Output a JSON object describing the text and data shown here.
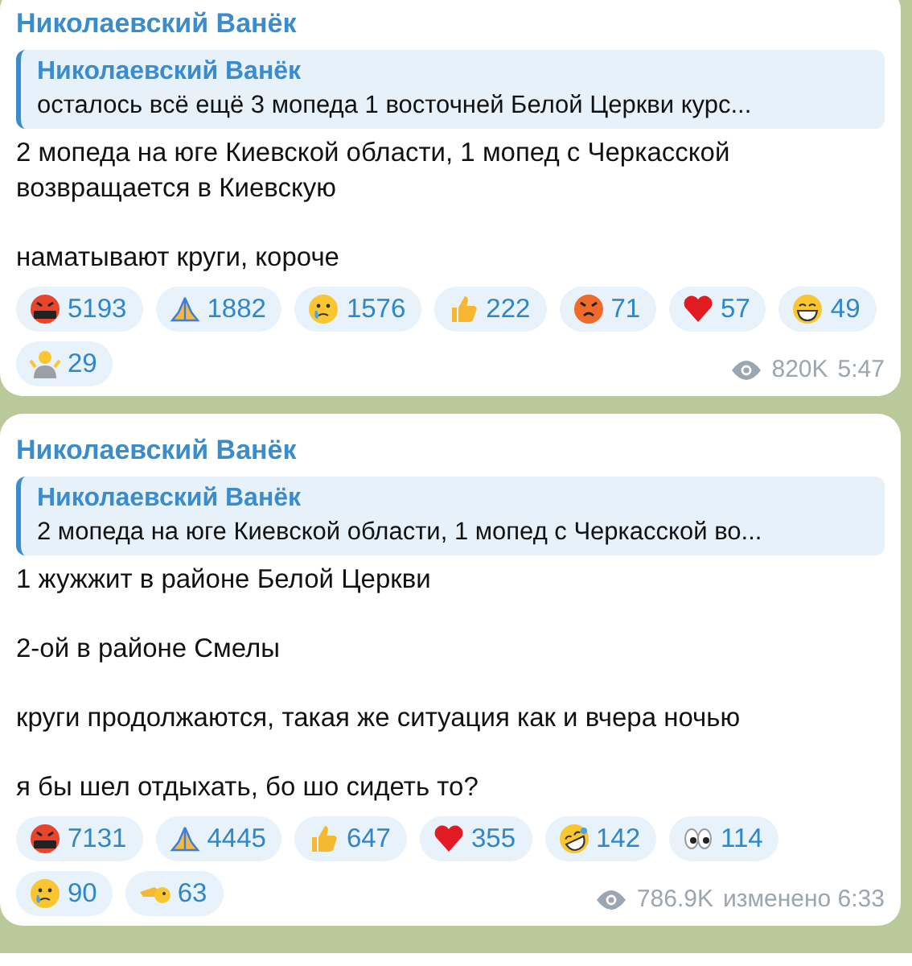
{
  "messages": [
    {
      "author": "Николаевский Ванёк",
      "reply": {
        "author": "Николаевский Ванёк",
        "text": "осталось всё ещё 3 мопеда  1 восточней Белой Церкви курс..."
      },
      "paragraphs": [
        "2 мопеда на юге Киевской области, 1 мопед с Черкасской возвращается в Киевскую",
        "наматывают круги, короче"
      ],
      "reactions": [
        {
          "kind": "cursing",
          "count": "5193"
        },
        {
          "kind": "pray",
          "count": "1882"
        },
        {
          "kind": "cry",
          "count": "1576"
        },
        {
          "kind": "thumbs",
          "count": "222"
        },
        {
          "kind": "angry",
          "count": "71"
        },
        {
          "kind": "heart",
          "count": "57"
        },
        {
          "kind": "grin",
          "count": "49"
        },
        {
          "kind": "shrug",
          "count": "29"
        }
      ],
      "views": "820K",
      "time": "5:47"
    },
    {
      "author": "Николаевский Ванёк",
      "reply": {
        "author": "Николаевский Ванёк",
        "text": "2 мопеда на юге Киевской области, 1 мопед с Черкасской во..."
      },
      "paragraphs": [
        "1 жужжит в районе Белой Церкви",
        "2-ой в районе Смелы",
        "круги продолжаются, такая же ситуация как и вчера ночью",
        "я бы шел отдыхать, бо шо сидеть то?"
      ],
      "reactions": [
        {
          "kind": "cursing",
          "count": "7131"
        },
        {
          "kind": "pray",
          "count": "4445"
        },
        {
          "kind": "thumbs",
          "count": "647"
        },
        {
          "kind": "heart",
          "count": "355"
        },
        {
          "kind": "rofl",
          "count": "142"
        },
        {
          "kind": "eyes",
          "count": "114"
        },
        {
          "kind": "cry",
          "count": "90"
        },
        {
          "kind": "salute",
          "count": "63"
        }
      ],
      "views": "786.9K",
      "time": "изменено 6:33"
    }
  ]
}
